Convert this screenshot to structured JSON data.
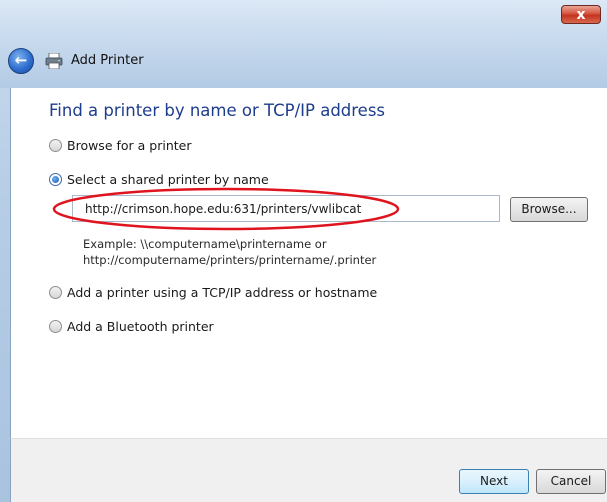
{
  "window": {
    "title": "Add Printer",
    "close_glyph": "x",
    "back_glyph": "←"
  },
  "page": {
    "heading": "Find a printer by name or TCP/IP address"
  },
  "options": [
    {
      "label": "Browse for a printer",
      "selected": false
    },
    {
      "label": "Select a shared printer by name",
      "selected": true
    },
    {
      "label": "Add a printer using a TCP/IP address or hostname",
      "selected": false
    },
    {
      "label": "Add a Bluetooth printer",
      "selected": false
    }
  ],
  "shared_printer": {
    "value": "http://crimson.hope.edu:631/printers/vwlibcat",
    "browse_label": "Browse...",
    "example_line1": "Example: \\\\computername\\printername or",
    "example_line2": "http://computername/printers/printername/.printer"
  },
  "footer": {
    "next_label": "Next",
    "cancel_label": "Cancel"
  },
  "colors": {
    "heading": "#1e3c8c",
    "highlight": "#e0141e"
  },
  "icons": {
    "back": "back-arrow-icon",
    "printer": "printer-icon",
    "close": "close-icon"
  }
}
